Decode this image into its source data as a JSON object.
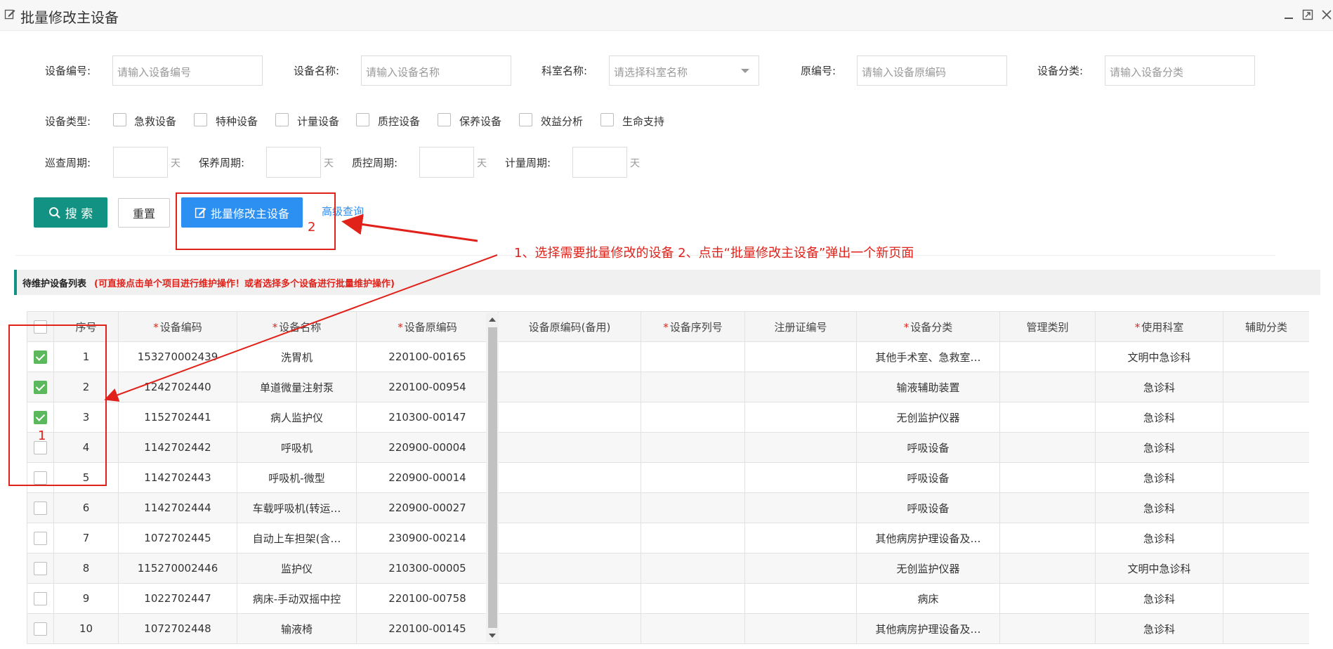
{
  "window": {
    "title": "批量修改主设备"
  },
  "search": {
    "device_code": {
      "label": "设备编号:",
      "placeholder": "请输入设备编号"
    },
    "device_name": {
      "label": "设备名称:",
      "placeholder": "请输入设备名称"
    },
    "dept_name": {
      "label": "科室名称:",
      "placeholder": "请选择科室名称"
    },
    "orig_code": {
      "label": "原编号:",
      "placeholder": "请输入设备原编码"
    },
    "category": {
      "label": "设备分类:",
      "placeholder": "请输入设备分类"
    },
    "device_type_label": "设备类型:",
    "device_types": [
      "急救设备",
      "特种设备",
      "计量设备",
      "质控设备",
      "保养设备",
      "效益分析",
      "生命支持"
    ],
    "periods": [
      {
        "label": "巡查周期:",
        "unit": "天"
      },
      {
        "label": "保养周期:",
        "unit": "天"
      },
      {
        "label": "质控周期:",
        "unit": "天"
      },
      {
        "label": "计量周期:",
        "unit": "天"
      }
    ]
  },
  "actions": {
    "search": "搜 索",
    "reset": "重置",
    "batch_edit": "批量修改主设备",
    "advanced": "高级查询"
  },
  "section": {
    "title": "待维护设备列表",
    "note": "(可直接点击单个项目进行维护操作！或者选择多个设备进行批量维护操作)"
  },
  "table": {
    "columns": [
      "序号",
      "设备编码",
      "设备名称",
      "设备原编码",
      "设备原编码(备用)",
      "设备序列号",
      "注册证编号",
      "设备分类",
      "管理类别",
      "使用科室",
      "辅助分类"
    ],
    "required": [
      false,
      true,
      true,
      true,
      false,
      true,
      false,
      true,
      false,
      true,
      false
    ],
    "rows": [
      {
        "checked": true,
        "no": "1",
        "code": "153270002439",
        "name": "洗胃机",
        "orig": "220100-00165",
        "category": "其他手术室、急救室…",
        "dept": "文明中急诊科"
      },
      {
        "checked": true,
        "no": "2",
        "code": "1242702440",
        "name": "单道微量注射泵",
        "orig": "220100-00954",
        "category": "输液辅助装置",
        "dept": "急诊科"
      },
      {
        "checked": true,
        "no": "3",
        "code": "1152702441",
        "name": "病人监护仪",
        "orig": "210300-00147",
        "category": "无创监护仪器",
        "dept": "急诊科"
      },
      {
        "checked": false,
        "no": "4",
        "code": "1142702442",
        "name": "呼吸机",
        "orig": "220900-00004",
        "category": "呼吸设备",
        "dept": "急诊科"
      },
      {
        "checked": false,
        "no": "5",
        "code": "1142702443",
        "name": "呼吸机-微型",
        "orig": "220900-00014",
        "category": "呼吸设备",
        "dept": "急诊科"
      },
      {
        "checked": false,
        "no": "6",
        "code": "1142702444",
        "name": "车载呼吸机(转运…",
        "orig": "220900-00027",
        "category": "呼吸设备",
        "dept": "急诊科"
      },
      {
        "checked": false,
        "no": "7",
        "code": "1072702445",
        "name": "自动上车担架(含…",
        "orig": "230900-00214",
        "category": "其他病房护理设备及…",
        "dept": "急诊科"
      },
      {
        "checked": false,
        "no": "8",
        "code": "115270002446",
        "name": "监护仪",
        "orig": "210300-00005",
        "category": "无创监护仪器",
        "dept": "文明中急诊科"
      },
      {
        "checked": false,
        "no": "9",
        "code": "1022702447",
        "name": "病床-手动双摇中控",
        "orig": "220100-00758",
        "category": "病床",
        "dept": "急诊科"
      },
      {
        "checked": false,
        "no": "10",
        "code": "1072702448",
        "name": "输液椅",
        "orig": "220100-00145",
        "category": "其他病房护理设备及…",
        "dept": "急诊科"
      }
    ]
  },
  "annotation": {
    "text": "1、选择需要批量修改的设备  2、点击“批量修改主设备”弹出一个新页面",
    "num1": "1",
    "num2": "2",
    "color": "#e0221a"
  },
  "colors": {
    "primary": "#129282",
    "blue": "#2c8ff2",
    "check": "#5cb85c"
  }
}
